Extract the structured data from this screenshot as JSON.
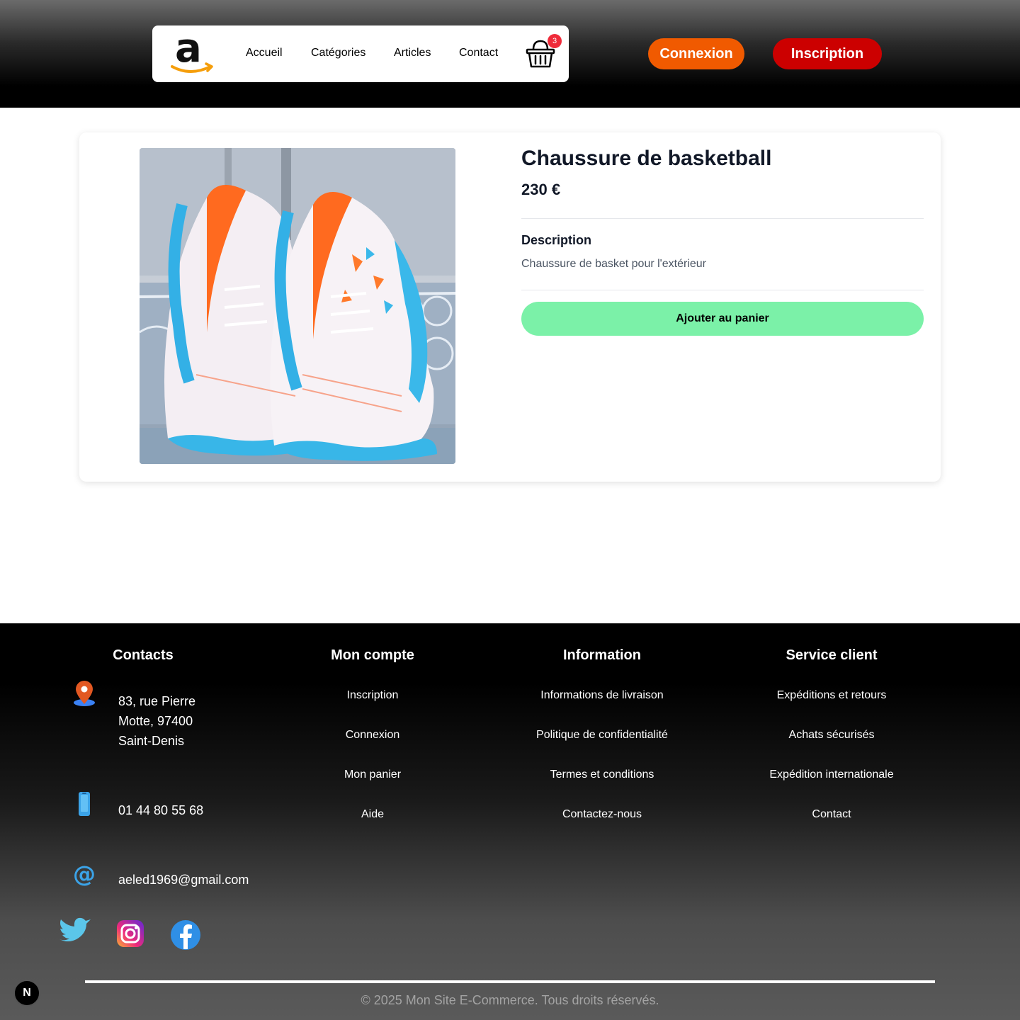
{
  "header": {
    "logo_letter": "a",
    "nav": [
      "Accueil",
      "Catégories",
      "Articles",
      "Contact"
    ],
    "cart_count": "3",
    "login_label": "Connexion",
    "signup_label": "Inscription"
  },
  "product": {
    "title": "Chaussure de basketball",
    "price": "230 €",
    "description_heading": "Description",
    "description": "Chaussure de basket pour l'extérieur",
    "add_to_cart_label": "Ajouter au panier"
  },
  "footer": {
    "contacts": {
      "heading": "Contacts",
      "address_lines": [
        "83, rue Pierre",
        "Motte, 97400",
        "Saint-Denis"
      ],
      "phone": "01 44 80 55 68",
      "email": "aeled1969@gmail.com"
    },
    "account": {
      "heading": "Mon compte",
      "links": [
        "Inscription",
        "Connexion",
        "Mon panier",
        "Aide"
      ]
    },
    "information": {
      "heading": "Information",
      "links": [
        "Informations de livraison",
        "Politique de confidentialité",
        "Termes et conditions",
        "Contactez-nous"
      ]
    },
    "service": {
      "heading": "Service client",
      "links": [
        "Expéditions et retours",
        "Achats sécurisés",
        "Expédition internationale",
        "Contact"
      ]
    },
    "copyright": "© 2025 Mon Site E-Commerce. Tous droits réservés.",
    "dev_badge": "N"
  },
  "colors": {
    "login": "#f05a00",
    "signup": "#cc0000",
    "add_to_cart": "#7bf1a8",
    "badge": "#ef2b3a"
  }
}
